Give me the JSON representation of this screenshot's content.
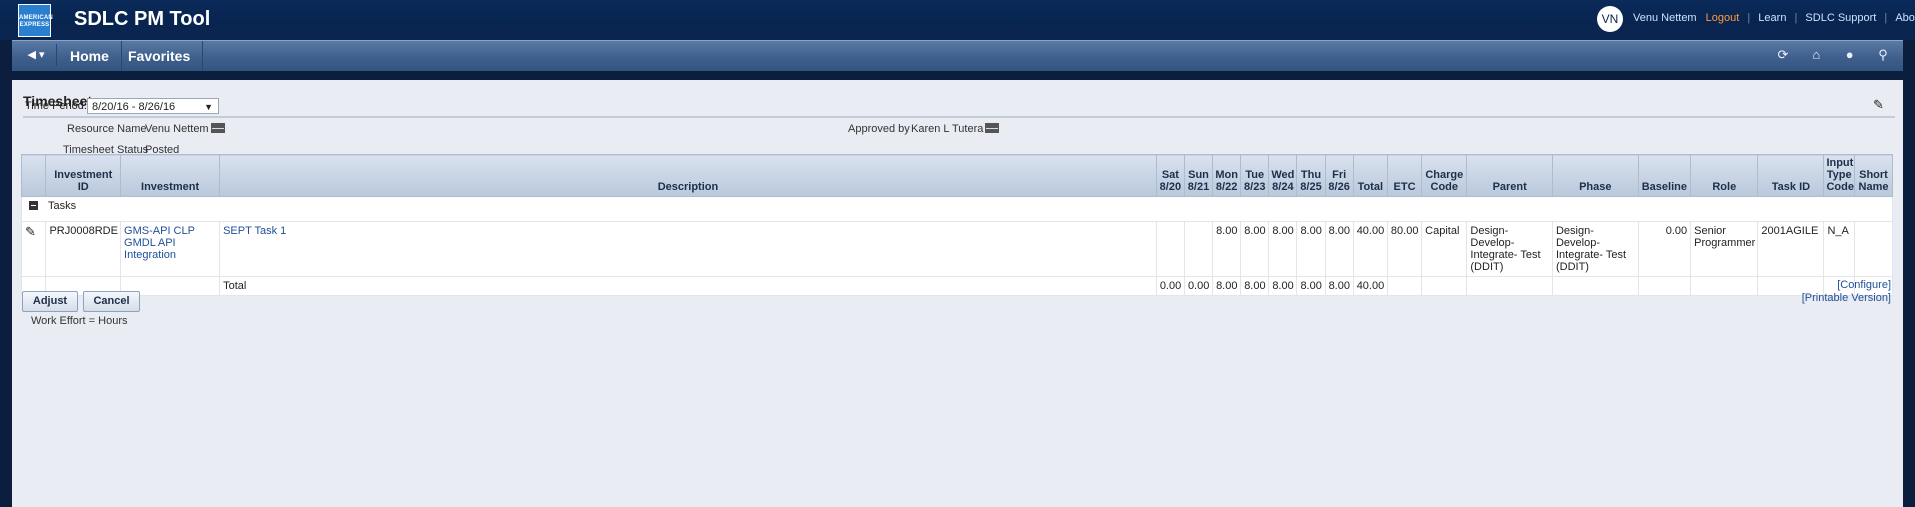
{
  "header": {
    "logo_text": "AMERICAN EXPRESS",
    "app_title": "SDLC PM Tool",
    "avatar_initials": "VN",
    "user_name": "Venu Nettem",
    "links": {
      "logout": "Logout",
      "learn": "Learn",
      "support": "SDLC Support",
      "about": "About"
    },
    "separator": "|"
  },
  "nav": {
    "back_icon": "◀ ▾",
    "home": "Home",
    "favorites": "Favorites",
    "icons": [
      "refresh-icon",
      "home-icon",
      "help-icon",
      "search-icon"
    ]
  },
  "page": {
    "title": "Timesheet",
    "time_period_label": "Time Period:",
    "time_period_value": "8/20/16 - 8/26/16",
    "resource_name_label": "Resource Name",
    "resource_name_value": "Venu Nettem",
    "approved_by_label": "Approved by",
    "approved_by_value": "Karen L Tutera",
    "status_label": "Timesheet Status",
    "status_value": "Posted"
  },
  "table": {
    "headers": {
      "investment_id": [
        "Investment",
        "ID"
      ],
      "investment": "Investment",
      "description": "Description",
      "days": [
        [
          "Sat",
          "8/20"
        ],
        [
          "Sun",
          "8/21"
        ],
        [
          "Mon",
          "8/22"
        ],
        [
          "Tue",
          "8/23"
        ],
        [
          "Wed",
          "8/24"
        ],
        [
          "Thu",
          "8/25"
        ],
        [
          "Fri",
          "8/26"
        ]
      ],
      "total": "Total",
      "etc": "ETC",
      "charge_code": [
        "Charge",
        "Code"
      ],
      "parent": "Parent",
      "phase": "Phase",
      "baseline": "Baseline",
      "role": "Role",
      "task_id": "Task ID",
      "input_type_code": [
        "Input",
        "Type",
        "Code"
      ],
      "short_name": [
        "Short",
        "Name"
      ]
    },
    "group_label": "Tasks",
    "row": {
      "investment_id": "PRJ0008RDE",
      "investment": "GMS-API CLP GMDL API Integration",
      "description": "SEPT Task 1",
      "days": [
        "",
        "",
        "8.00",
        "8.00",
        "8.00",
        "8.00",
        "8.00"
      ],
      "total": "40.00",
      "etc": "80.00",
      "charge_code": "Capital",
      "parent": "Design-Develop-Integrate- Test (DDIT)",
      "phase": "Design-Develop-Integrate- Test (DDIT)",
      "baseline": "0.00",
      "role": "Senior Programmer",
      "task_id": "2001AGILE",
      "input_type_code": "N_A",
      "short_name": ""
    },
    "total_row": {
      "label": "Total",
      "days": [
        "0.00",
        "0.00",
        "8.00",
        "8.00",
        "8.00",
        "8.00",
        "8.00"
      ],
      "total": "40.00"
    }
  },
  "links": {
    "configure": "[Configure]",
    "printable": "[Printable Version]"
  },
  "buttons": {
    "adjust": "Adjust",
    "cancel": "Cancel"
  },
  "footnote": "Work Effort = Hours"
}
